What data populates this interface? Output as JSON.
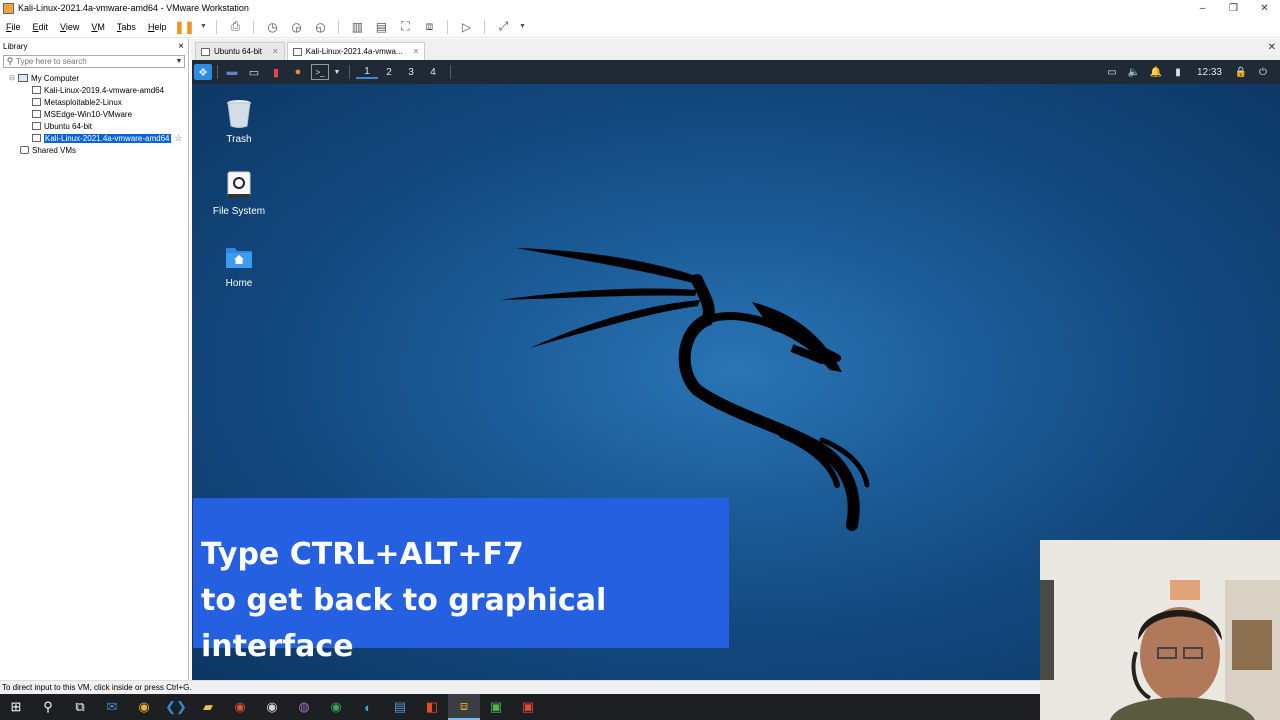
{
  "window": {
    "title": "Kali-Linux-2021.4a-vmware-amd64 - VMware Workstation",
    "controls": [
      "–",
      "❐",
      "✕"
    ]
  },
  "menu": {
    "items": [
      "File",
      "Edit",
      "View",
      "VM",
      "Tabs",
      "Help"
    ]
  },
  "library": {
    "header": "Library",
    "close": "×",
    "search_placeholder": "Type here to search",
    "tree": {
      "root": "My Computer",
      "vms": [
        "Kali-Linux-2019.4-vmware-amd64",
        "Metasploitable2-Linux",
        "MSEdge-Win10-VMware",
        "Ubuntu 64-bit",
        "Kali-Linux-2021.4a-vmware-amd64"
      ],
      "shared": "Shared VMs"
    }
  },
  "tabs": [
    {
      "label": "Ubuntu 64-bit",
      "active": false
    },
    {
      "label": "Kali-Linux-2021.4a-vmwa...",
      "active": true
    }
  ],
  "kali": {
    "workspaces": [
      "1",
      "2",
      "3",
      "4"
    ],
    "clock": "12:33",
    "desktop_icons": [
      {
        "label": "Trash",
        "icon": "trash-icon"
      },
      {
        "label": "File System",
        "icon": "drive-icon"
      },
      {
        "label": "Home",
        "icon": "home-folder-icon"
      }
    ]
  },
  "caption": {
    "line1": "Type CTRL+ALT+F7",
    "line2": "to get back to graphical interface"
  },
  "statusbar": {
    "text": "To direct input to this VM, click inside or press Ctrl+G."
  },
  "colors": {
    "caption_bg": "#2560e0",
    "selection": "#0a64d6",
    "kali_panel": "#202a36"
  }
}
